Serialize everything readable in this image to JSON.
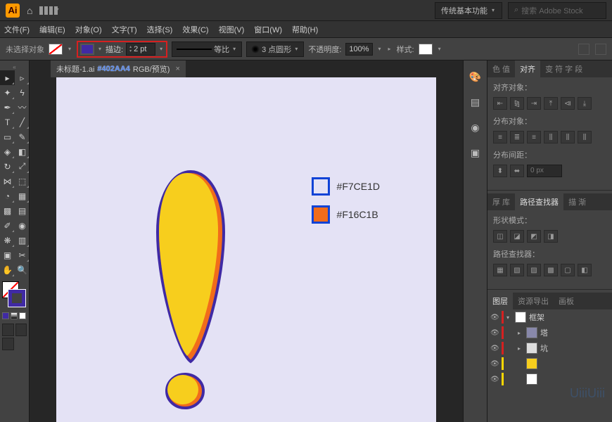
{
  "app": {
    "logo": "Ai"
  },
  "workspace": {
    "name": "传统基本功能",
    "search_placeholder": "搜索 Adobe Stock"
  },
  "menu": [
    "文件(F)",
    "编辑(E)",
    "对象(O)",
    "文字(T)",
    "选择(S)",
    "效果(C)",
    "视图(V)",
    "窗口(W)",
    "帮助(H)"
  ],
  "controlbar": {
    "no_selection": "未选择对象",
    "stroke_label": "描边:",
    "stroke_weight": "2 pt",
    "profile_label": "等比",
    "brush_label": "3 点圆形",
    "opacity_label": "不透明度:",
    "opacity_value": "100%",
    "style_label": "样式:"
  },
  "document": {
    "tab_prefix": "未标题-1.ai",
    "tab_hex": "#402AA4",
    "tab_suffix": "RGB/预览)"
  },
  "legend": {
    "c1": "#F7CE1D",
    "c2": "#F16C1B"
  },
  "panels": {
    "group1": {
      "tabs": [
        "色 值",
        "对齐",
        "变 符 字 段"
      ],
      "active": 1,
      "align_label": "对齐对象：",
      "dist_label": "分布对象：",
      "spacing_label": "分布间距：",
      "px_val": "0 px"
    },
    "group2": {
      "tabs": [
        "厚 库",
        "路径查找器",
        "描 渐"
      ],
      "active": 1,
      "shape_label": "形状模式：",
      "pf_label": "路径查找器："
    },
    "group3": {
      "tabs": [
        "图层",
        "资源导出",
        "画板"
      ],
      "active": 0
    }
  },
  "layers": [
    {
      "color": "#d62020",
      "name": "框架",
      "indent": 0,
      "arrow": "▾",
      "thumb": "#fff"
    },
    {
      "color": "#d62020",
      "name": "塔",
      "indent": 1,
      "arrow": "▸",
      "thumb": "#88a"
    },
    {
      "color": "#d62020",
      "name": "坑",
      "indent": 1,
      "arrow": "▸",
      "thumb": "#ddd"
    },
    {
      "color": "#ffd700",
      "name": "",
      "indent": 1,
      "arrow": "",
      "thumb": "#F7CE1D"
    },
    {
      "color": "#ffd700",
      "name": "",
      "indent": 1,
      "arrow": "",
      "thumb": "#fff"
    }
  ],
  "watermark": "UiiiUiii"
}
